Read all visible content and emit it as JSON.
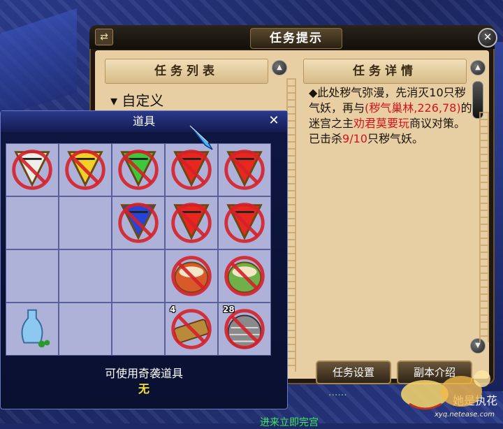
{
  "quest_panel": {
    "title": "任务提示",
    "list_header": "任务列表",
    "detail_header": "任务详情",
    "list_items": [
      "▾ 自定义"
    ],
    "detail": {
      "part1": "◆此处秽气弥漫，先消灭10只秽气妖，再与",
      "location": "(秽气巢林,226,78)",
      "part2": "的迷宫之主",
      "npc": "劝君莫要玩",
      "part3": "商议对策。已击杀",
      "kill_count": "9/10",
      "part4": "只秽气妖。"
    },
    "buttons": {
      "task_settings": "任务设置",
      "dungeon_intro": "副本介绍"
    }
  },
  "items_panel": {
    "title": "道具",
    "usable_label": "可使用奇袭道具",
    "usable_value": "无",
    "slots": [
      {
        "icon": "white-flag-icon",
        "count": "",
        "disabled": true
      },
      {
        "icon": "yellow-flag-icon",
        "count": "",
        "disabled": true
      },
      {
        "icon": "green-flag-icon",
        "count": "",
        "disabled": true
      },
      {
        "icon": "red-flag-icon",
        "count": "",
        "disabled": true
      },
      {
        "icon": "red-flag-icon",
        "count": "",
        "disabled": true
      },
      {
        "icon": "",
        "count": "",
        "disabled": false
      },
      {
        "icon": "",
        "count": "",
        "disabled": false
      },
      {
        "icon": "blue-flag-icon",
        "count": "",
        "disabled": true
      },
      {
        "icon": "red-flag-icon",
        "count": "",
        "disabled": true
      },
      {
        "icon": "red-flag-icon",
        "count": "",
        "disabled": true
      },
      {
        "icon": "",
        "count": "",
        "disabled": false
      },
      {
        "icon": "",
        "count": "",
        "disabled": false
      },
      {
        "icon": "",
        "count": "",
        "disabled": false
      },
      {
        "icon": "red-bowl-icon",
        "count": "",
        "disabled": true
      },
      {
        "icon": "green-bowl-icon",
        "count": "",
        "disabled": true
      },
      {
        "icon": "vase-icon",
        "count": "",
        "disabled": false
      },
      {
        "icon": "",
        "count": "",
        "disabled": false
      },
      {
        "icon": "",
        "count": "",
        "disabled": false
      },
      {
        "icon": "scroll-icon",
        "count": "4",
        "disabled": true
      },
      {
        "icon": "jar-icon",
        "count": "28",
        "disabled": true
      }
    ]
  },
  "background": {
    "text1": "她是执花",
    "text2": "进来立即完宫"
  },
  "watermark": {
    "url": "xyq.netease.com"
  },
  "colors": {
    "quest_bg": "#e7cfa3",
    "quest_frame": "#201810",
    "items_bg": "#0f1640",
    "slot_bg": "#aeb2d8",
    "highlight_red": "#d8121a",
    "value_yellow": "#f3e23a"
  }
}
